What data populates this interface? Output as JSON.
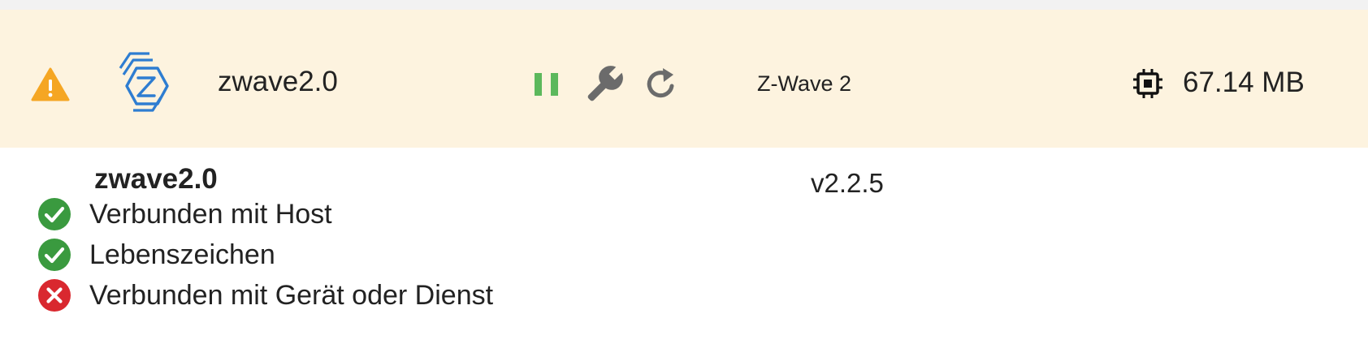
{
  "instance": {
    "name": "zwave2.0",
    "title": "Z-Wave 2",
    "memory": "67.14 MB",
    "version": "v2.2.5",
    "status_items": [
      {
        "label": "Verbunden mit Host",
        "ok": true
      },
      {
        "label": "Lebenszeichen",
        "ok": true
      },
      {
        "label": "Verbunden mit Gerät oder Dienst",
        "ok": false
      }
    ]
  },
  "icons": {
    "warning": "warning-triangle-icon",
    "logo": "zwave-logo-icon",
    "pause": "pause-icon",
    "settings": "wrench-icon",
    "restart": "restart-icon",
    "memory": "cpu-chip-icon",
    "ok": "check-circle-icon",
    "error": "x-circle-icon"
  },
  "colors": {
    "row_background": "#fdf3df",
    "warning": "#f5a623",
    "logo_blue": "#2e7dd1",
    "running_green": "#5cb85c",
    "ok_green": "#3a9a3f",
    "error_red": "#d9282f",
    "icon_gray": "#6b6b6b"
  }
}
